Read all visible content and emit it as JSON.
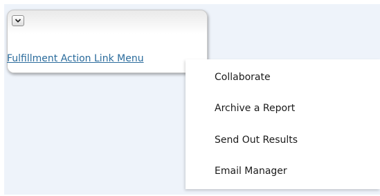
{
  "trigger": {
    "icon": "chevron-down-icon",
    "link_text": "Fulfillment Action Link Menu"
  },
  "menu": {
    "items": [
      {
        "label": "Collaborate"
      },
      {
        "label": "Archive a Report"
      },
      {
        "label": "Send Out Results"
      },
      {
        "label": "Email Manager"
      }
    ]
  },
  "colors": {
    "panel_background": "#eef3fa",
    "link": "#2a6b9c",
    "menu_text": "#1a1a1a"
  }
}
